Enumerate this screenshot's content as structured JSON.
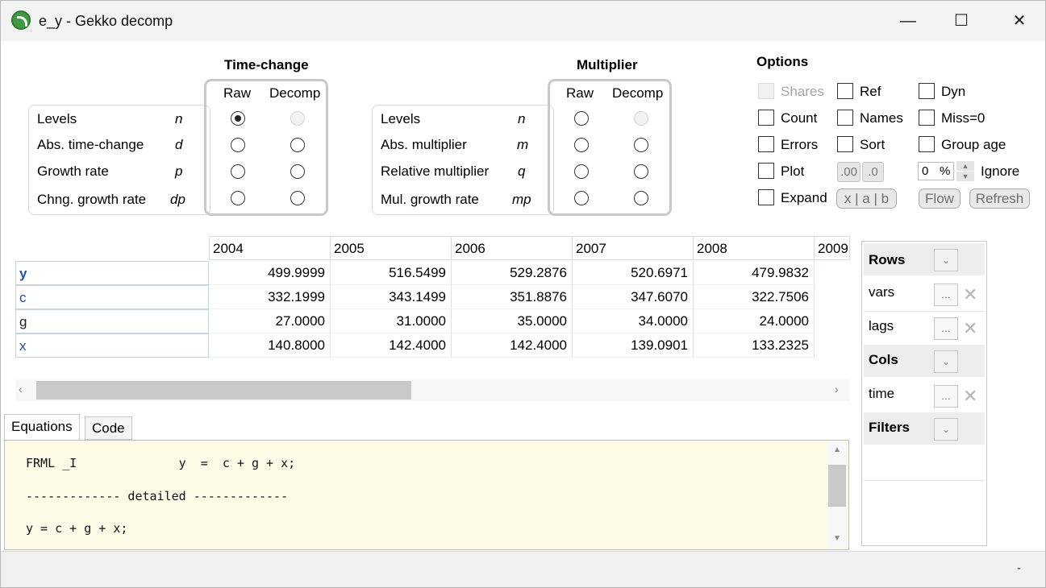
{
  "window": {
    "title": "e_y - Gekko decomp",
    "minimize": "—",
    "maximize": "☐",
    "close": "✕"
  },
  "time_change": {
    "heading": "Time-change",
    "col_raw": "Raw",
    "col_decomp": "Decomp",
    "rows": [
      {
        "label": "Levels",
        "code": "n"
      },
      {
        "label": "Abs. time-change",
        "code": "d"
      },
      {
        "label": "Growth rate",
        "code": "p"
      },
      {
        "label": "Chng. growth rate",
        "code": "dp"
      }
    ]
  },
  "multiplier": {
    "heading": "Multiplier",
    "col_raw": "Raw",
    "col_decomp": "Decomp",
    "rows": [
      {
        "label": "Levels",
        "code": "n"
      },
      {
        "label": "Abs. multiplier",
        "code": "m"
      },
      {
        "label": "Relative multiplier",
        "code": "q"
      },
      {
        "label": "Mul. growth rate",
        "code": "mp"
      }
    ]
  },
  "options": {
    "heading": "Options",
    "shares": "Shares",
    "ref": "Ref",
    "dyn": "Dyn",
    "count": "Count",
    "names": "Names",
    "miss0": "Miss=0",
    "errors": "Errors",
    "sort": "Sort",
    "group_age": "Group age",
    "plot": "Plot",
    "dec00": ".00",
    "dec0": ".0",
    "ignore_value": "0",
    "ignore_unit": "%",
    "ignore": "Ignore",
    "expand": "Expand",
    "xab": "x | a | b",
    "flow": "Flow",
    "refresh": "Refresh"
  },
  "grid": {
    "columns": [
      "2004",
      "2005",
      "2006",
      "2007",
      "2008",
      "2009"
    ],
    "rows": [
      {
        "name": "y",
        "values": [
          "499.9999",
          "516.5499",
          "529.2876",
          "520.6971",
          "479.9832"
        ]
      },
      {
        "name": "c",
        "values": [
          "332.1999",
          "343.1499",
          "351.8876",
          "347.6070",
          "322.7506"
        ]
      },
      {
        "name": "g",
        "values": [
          "27.0000",
          "31.0000",
          "35.0000",
          "34.0000",
          "24.0000"
        ]
      },
      {
        "name": "x",
        "values": [
          "140.8000",
          "142.4000",
          "142.4000",
          "139.0901",
          "133.2325"
        ]
      }
    ]
  },
  "pivot": {
    "rows_label": "Rows",
    "rows_items": [
      "vars",
      "lags"
    ],
    "cols_label": "Cols",
    "cols_items": [
      "time"
    ],
    "filters_label": "Filters",
    "ellipsis": "...",
    "remove": "✕",
    "dropdown": "⌄"
  },
  "tabs": {
    "equations": "Equations",
    "code": "Code"
  },
  "code": {
    "line1": "FRML _I              y  =  c + g + x;",
    "line2": "------------- detailed -------------",
    "line3": "y = c + g + x;"
  },
  "status": {
    "dash": "-"
  }
}
